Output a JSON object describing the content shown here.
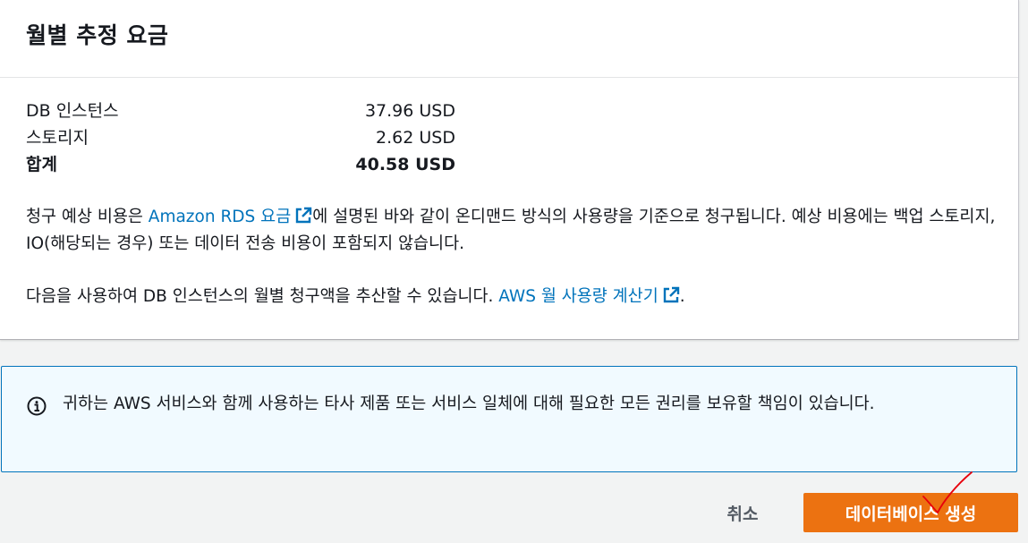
{
  "panel": {
    "title": "월별 추정 요금",
    "costs": [
      {
        "label": "DB 인스턴스",
        "value": "37.96 USD"
      },
      {
        "label": "스토리지",
        "value": "2.62 USD"
      }
    ],
    "total": {
      "label": "합계",
      "value": "40.58 USD"
    },
    "billing_note": {
      "prefix": "청구 예상 비용은 ",
      "link_text": "Amazon RDS 요금",
      "suffix": "에 설명된 바와 같이 온디맨드 방식의 사용량을 기준으로 청구됩니다. 예상 비용에는 백업 스토리지, IO(해당되는 경우) 또는 데이터 전송 비용이 포함되지 않습니다."
    },
    "calculator_note": {
      "prefix": "다음을 사용하여 DB 인스턴스의 월별 청구액을 추산할 수 있습니다. ",
      "link_text": "AWS 월 사용량 계산기",
      "suffix": "."
    }
  },
  "info_box": {
    "icon": "info-icon",
    "text": "귀하는 AWS 서비스와 함께 사용하는 타사 제품 또는 서비스 일체에 대해 필요한 모든 권리를 보유할 책임이 있습니다."
  },
  "actions": {
    "cancel_label": "취소",
    "create_label": "데이터베이스 생성"
  },
  "colors": {
    "link": "#0073bb",
    "primary_button": "#ec7211",
    "info_border": "#0073bb",
    "info_background": "#f1faff",
    "annotation": "#e8000b"
  }
}
